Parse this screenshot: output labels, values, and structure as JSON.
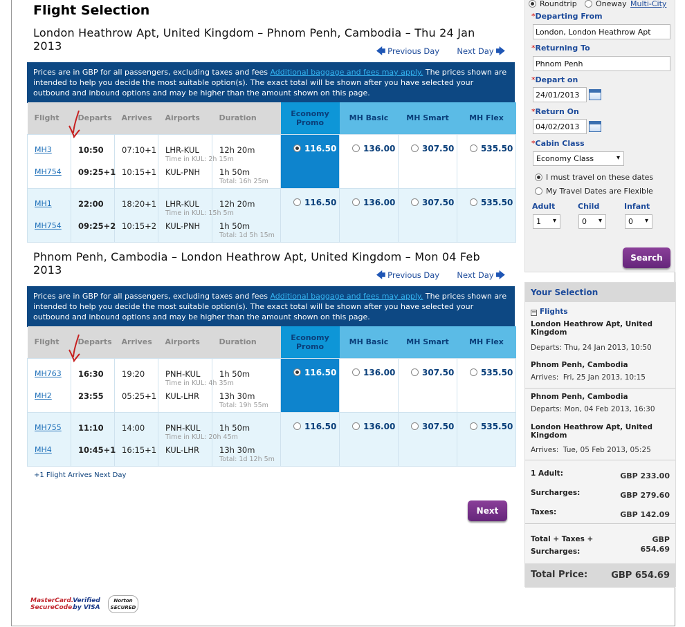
{
  "title": "Flight Selection",
  "outbound": {
    "route": "London Heathrow Apt, United Kingdom – Phnom Penh, Cambodia – Thu 24 Jan 2013",
    "prev_day": "Previous Day",
    "next_day": "Next Day",
    "rows": [
      {
        "legs": [
          {
            "flight": "MH3",
            "departs": "10:50",
            "arrives": "07:10+1",
            "airports": "LHR-KUL",
            "duration": "12h 20m",
            "extra": "Time in KUL: 2h 15m"
          },
          {
            "flight": "MH754",
            "departs": "09:25+1",
            "arrives": "10:15+1",
            "airports": "KUL-PNH",
            "duration": "1h 50m",
            "extra": "Total: 16h 25m"
          }
        ],
        "fares": [
          "116.50",
          "136.00",
          "307.50",
          "535.50"
        ],
        "selected": true
      },
      {
        "legs": [
          {
            "flight": "MH1",
            "departs": "22:00",
            "arrives": "18:20+1",
            "airports": "LHR-KUL",
            "duration": "12h 20m",
            "extra": "Time in KUL: 15h 5m"
          },
          {
            "flight": "MH754",
            "departs": "09:25+2",
            "arrives": "10:15+2",
            "airports": "KUL-PNH",
            "duration": "1h 50m",
            "extra": "Total: 1d 5h 15m"
          }
        ],
        "fares": [
          "116.50",
          "136.00",
          "307.50",
          "535.50"
        ],
        "selected": false
      }
    ]
  },
  "inbound": {
    "route": "Phnom Penh, Cambodia – London Heathrow Apt, United Kingdom – Mon 04 Feb 2013",
    "prev_day": "Previous Day",
    "next_day": "Next Day",
    "rows": [
      {
        "legs": [
          {
            "flight": "MH763",
            "departs": "16:30",
            "arrives": "19:20",
            "airports": "PNH-KUL",
            "duration": "1h 50m",
            "extra": "Time in KUL: 4h 35m"
          },
          {
            "flight": "MH2",
            "departs": "23:55",
            "arrives": "05:25+1",
            "airports": "KUL-LHR",
            "duration": "13h 30m",
            "extra": "Total: 19h 55m"
          }
        ],
        "fares": [
          "116.50",
          "136.00",
          "307.50",
          "535.50"
        ],
        "selected": true
      },
      {
        "legs": [
          {
            "flight": "MH755",
            "departs": "11:10",
            "arrives": "14:00",
            "airports": "PNH-KUL",
            "duration": "1h 50m",
            "extra": "Time in KUL: 20h 45m"
          },
          {
            "flight": "MH4",
            "departs": "10:45+1",
            "arrives": "16:15+1",
            "airports": "KUL-LHR",
            "duration": "13h 30m",
            "extra": "Total: 1d 12h 5m"
          }
        ],
        "fares": [
          "116.50",
          "136.00",
          "307.50",
          "535.50"
        ],
        "selected": false
      }
    ]
  },
  "note": {
    "text1": "Prices are in GBP for all passengers, excluding taxes and fees ",
    "link": "Additional baggage and fees may apply.",
    "text2": " The prices shown are intended to help you decide the most suitable option(s). The exact total will be shown after you have selected your outbound and inbound options and may be higher than the amount shown on this page."
  },
  "headers": {
    "flight": "Flight",
    "departs": "Departs",
    "arrives": "Arrives",
    "airports": "Airports",
    "duration": "Duration",
    "fares": [
      "Economy Promo",
      "MH Basic",
      "MH Smart",
      "MH Flex"
    ]
  },
  "legend": "+1   Flight Arrives Next Day",
  "next_button": "Next",
  "search_panel": {
    "trip_types": [
      "Roundtrip",
      "Oneway",
      "Multi-City"
    ],
    "selected_trip": "Roundtrip",
    "departing_label": "Departing From",
    "departing_value": "London, London Heathrow Apt",
    "returning_label": "Returning To",
    "returning_value": "Phnom Penh",
    "depart_on_label": "Depart on",
    "depart_on_value": "24/01/2013",
    "return_on_label": "Return On",
    "return_on_value": "04/02/2013",
    "cabin_label": "Cabin Class",
    "cabin_value": "Economy Class",
    "date_fixed": "I must travel on these dates",
    "date_flexible": "My Travel Dates are Flexible",
    "adult_label": "Adult",
    "adult_value": "1",
    "child_label": "Child",
    "child_value": "0",
    "infant_label": "Infant",
    "infant_value": "0",
    "search_button": "Search"
  },
  "your_selection": {
    "title": "Your Selection",
    "flights_label": "Flights",
    "out_from": "London Heathrow Apt, United Kingdom",
    "out_departs_label": "Departs:",
    "out_departs": "Thu, 24 Jan 2013, 10:50",
    "out_to": "Phnom Penh, Cambodia",
    "out_arrives_label": "Arrives:",
    "out_arrives": "Fri, 25 Jan 2013, 10:15",
    "in_from": "Phnom Penh, Cambodia",
    "in_departs_label": "Departs:",
    "in_departs": "Mon, 04 Feb 2013, 16:30",
    "in_to": "London Heathrow Apt, United Kingdom",
    "in_arrives_label": "Arrives:",
    "in_arrives": "Tue, 05 Feb 2013, 05:25",
    "adult_label": "1 Adult:",
    "adult_value": "GBP 233.00",
    "surcharges_label": "Surcharges:",
    "surcharges_value": "GBP 279.60",
    "taxes_label": "Taxes:",
    "taxes_value": "GBP 142.09",
    "total_label": "Total + Taxes + Surcharges:",
    "total_value": "GBP 654.69",
    "total_price_label": "Total Price:",
    "total_price_value": "GBP 654.69"
  },
  "logos": [
    "MasterCard. SecureCode.",
    "Verified by VISA",
    "Norton SECURED"
  ]
}
